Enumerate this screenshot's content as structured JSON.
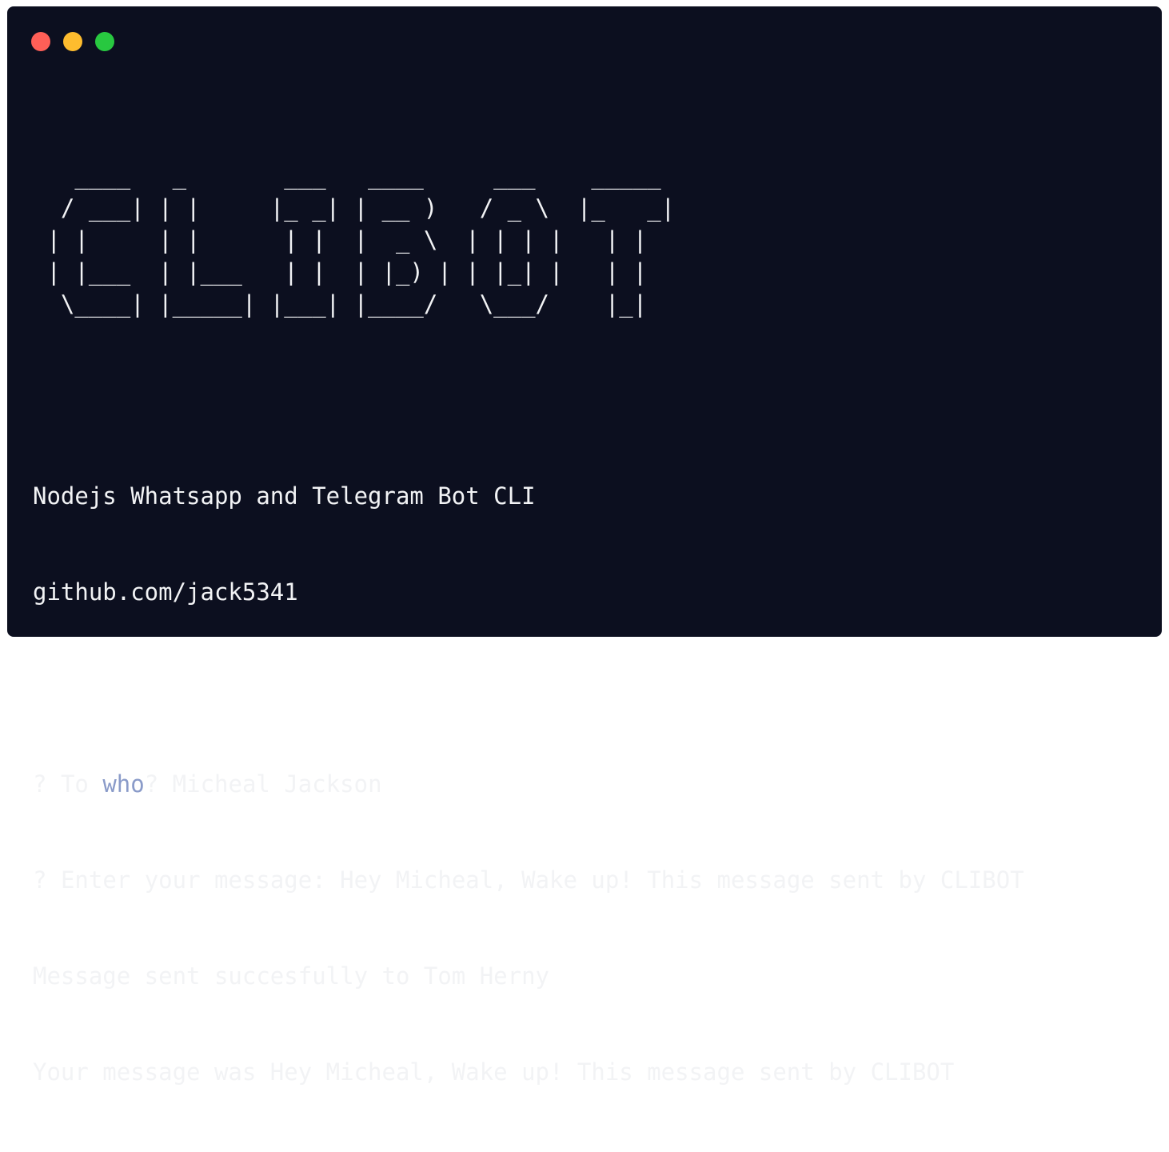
{
  "colors": {
    "window_bg": "#0c0f1f",
    "text": "#f2f3f5",
    "highlight": "#8a9bc9",
    "close": "#ff5f57",
    "minimize": "#febc2e",
    "maximize": "#28c840"
  },
  "window_controls": [
    "close-icon",
    "minimize-icon",
    "maximize-icon"
  ],
  "ascii_logo": "   ____   _       ___   ____     ___    _____\n  / ___| | |     |_ _| | __ )   / _ \\  |_   _|\n | |     | |      | |  |  _ \\  | | | |   | |\n | |___  | |___   | |  | |_) | | |_| |   | |\n  \\____| |_____| |___| |____/   \\___/    |_|",
  "banner": {
    "description": "Nodejs Whatsapp and Telegram Bot CLI",
    "github": "github.com/jack5341"
  },
  "prompt1": {
    "mark": "?",
    "prefix": "To",
    "highlight": "who",
    "suffix": "?",
    "answer": "Micheal Jackson"
  },
  "prompt2": {
    "mark": "?",
    "question": "Enter your message:",
    "answer": "Hey Micheal, Wake up! This message sent by CLIBOT"
  },
  "output": {
    "sent": "Message sent succesfully to Tom Herny",
    "echo": "Your message was Hey Micheal, Wake up! This message sent by CLIBOT"
  }
}
